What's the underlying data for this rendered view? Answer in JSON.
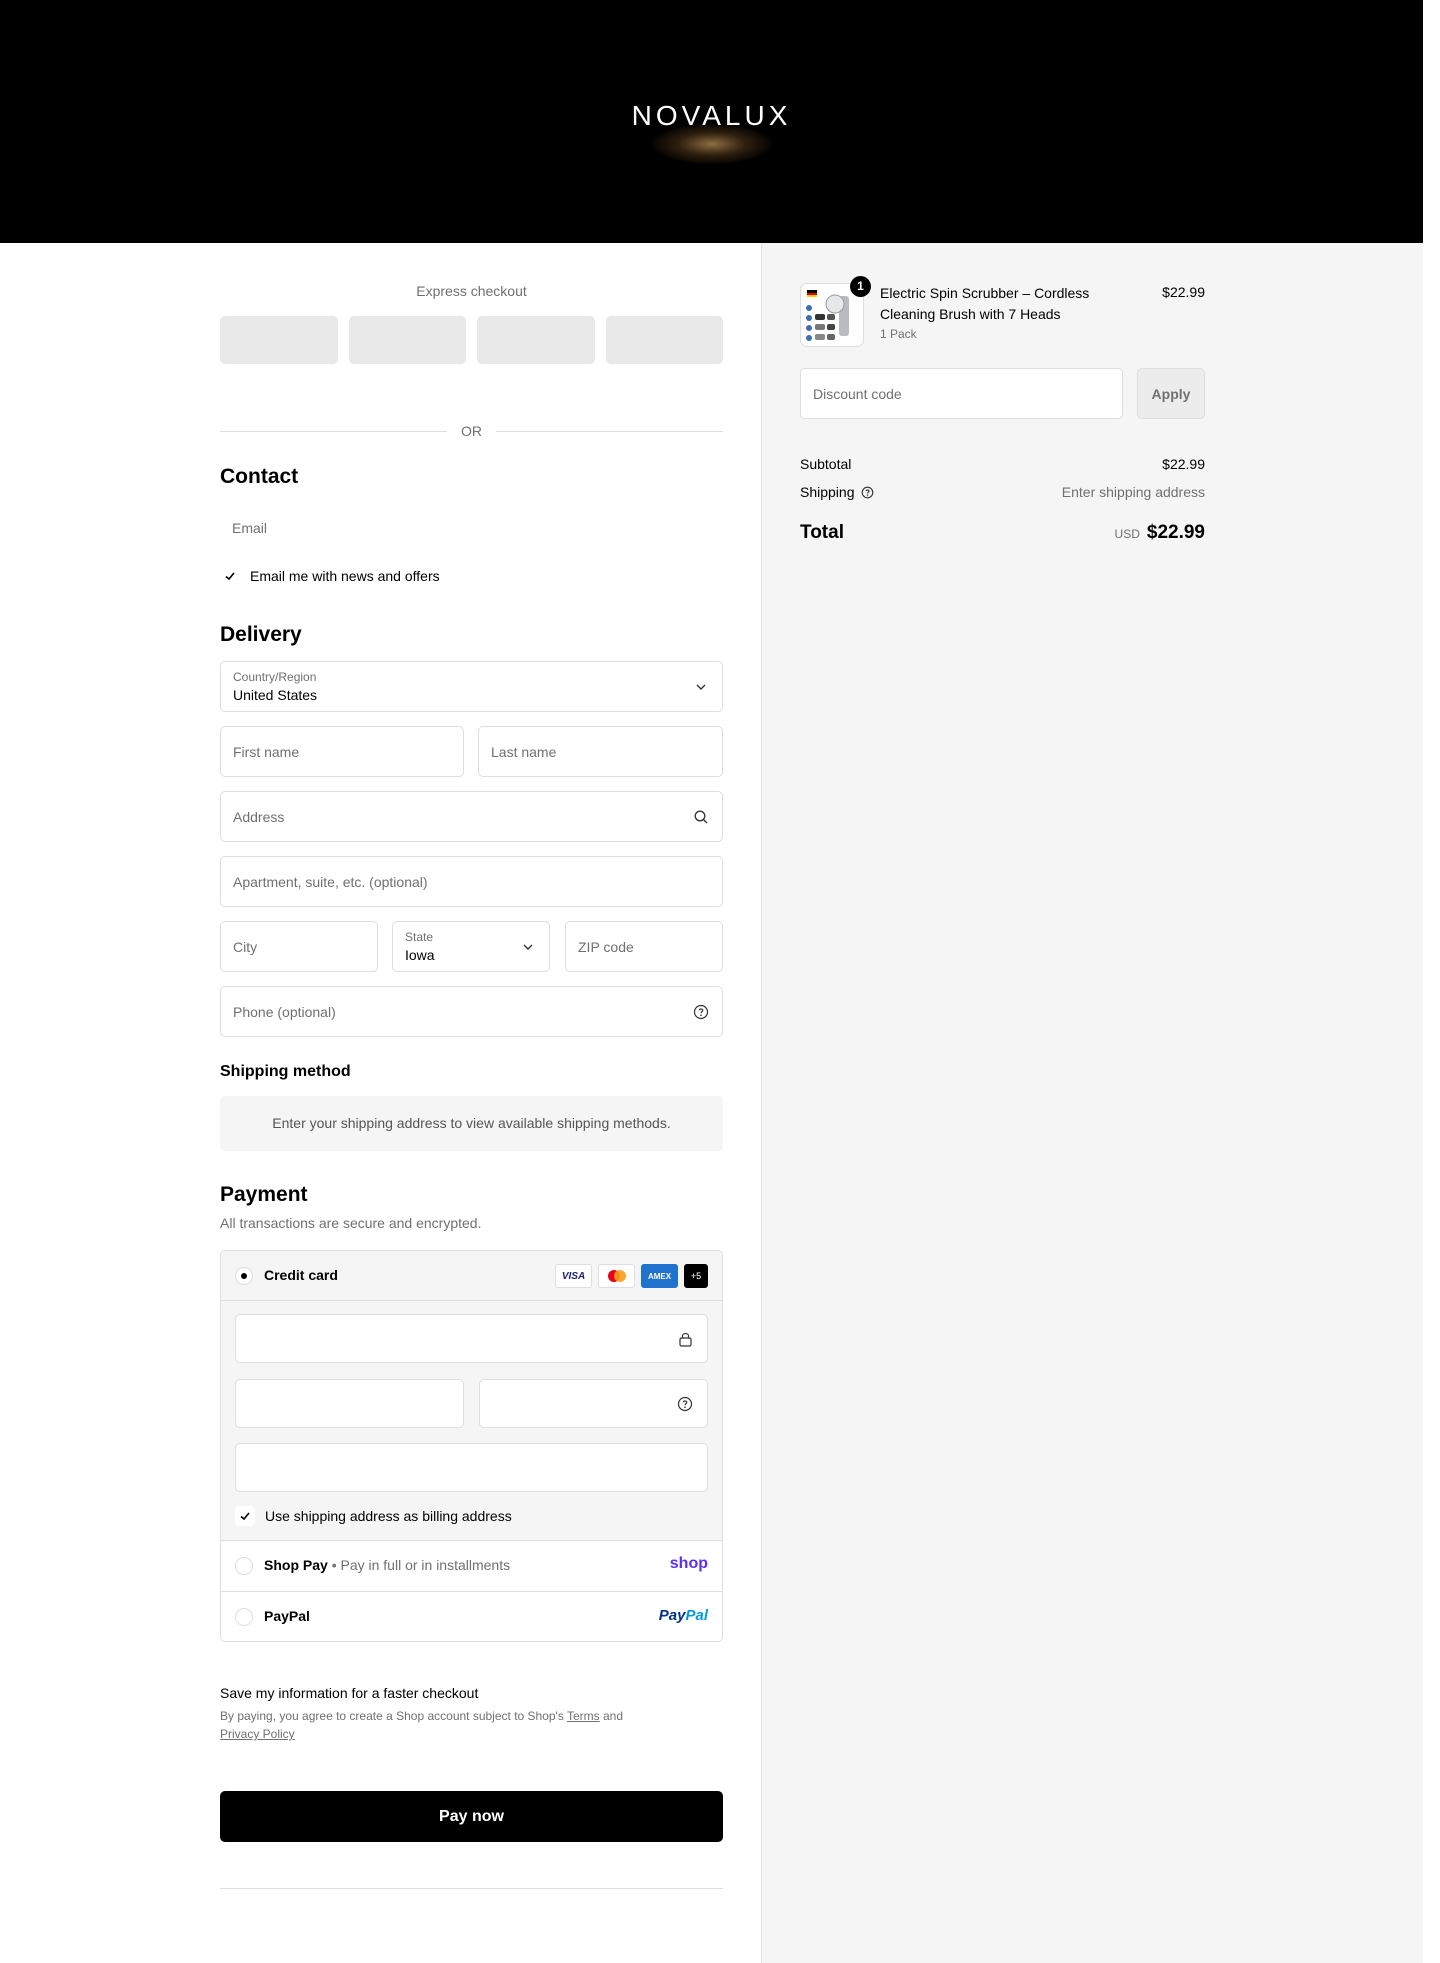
{
  "brand": {
    "logo_text": "NOVALUX"
  },
  "express": {
    "title": "Express checkout",
    "or_label": "OR"
  },
  "contact": {
    "heading": "Contact",
    "email_placeholder": "Email",
    "newsletter_label": "Email me with news and offers"
  },
  "delivery": {
    "heading": "Delivery",
    "country_label": "Country/Region",
    "country_value": "United States",
    "first_name_placeholder": "First name",
    "last_name_placeholder": "Last name",
    "address_placeholder": "Address",
    "apartment_placeholder": "Apartment, suite, etc. (optional)",
    "city_placeholder": "City",
    "state_label": "State",
    "state_value": "Iowa",
    "zip_placeholder": "ZIP code",
    "phone_placeholder": "Phone (optional)"
  },
  "shipping_method": {
    "heading": "Shipping method",
    "message": "Enter your shipping address to view available shipping methods."
  },
  "payment": {
    "heading": "Payment",
    "subtitle": "All transactions are secure and encrypted.",
    "credit_card_label": "Credit card",
    "card_brands": [
      "VISA",
      "AMEX"
    ],
    "more_cards": "+5",
    "billing_same_label": "Use shipping address as billing address",
    "shop_pay_label": "Shop Pay",
    "shop_pay_sep": "•",
    "shop_pay_desc": "Pay in full or in installments",
    "shop_brand": "shop",
    "paypal_label": "PayPal",
    "paypal_brand_1": "Pay",
    "paypal_brand_2": "Pal"
  },
  "save_info": {
    "title": "Save my information for a faster checkout",
    "legal_prefix": "By paying, you agree to create a Shop account subject to Shop's",
    "terms_link": "Terms",
    "and": "and",
    "privacy_link": "Privacy Policy"
  },
  "pay_now_label": "Pay now",
  "summary": {
    "product_name": "Electric Spin Scrubber – Cordless Cleaning Brush with 7 Heads",
    "product_variant": "1 Pack",
    "product_price": "$22.99",
    "quantity": "1",
    "discount_placeholder": "Discount code",
    "apply_label": "Apply",
    "subtotal_label": "Subtotal",
    "subtotal_value": "$22.99",
    "shipping_label": "Shipping",
    "shipping_value": "Enter shipping address",
    "total_label": "Total",
    "total_currency": "USD",
    "total_value": "$22.99"
  },
  "colors": {
    "header_bg": "#000000",
    "summary_bg": "#f5f5f5",
    "shop_pay_purple": "#5a31f4",
    "paypal_dark": "#003087",
    "paypal_light": "#009cde",
    "amex_blue": "#1f72cd"
  }
}
